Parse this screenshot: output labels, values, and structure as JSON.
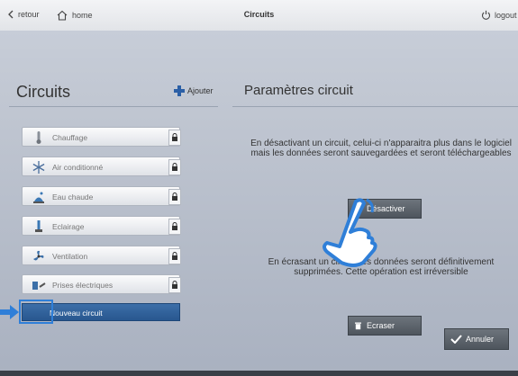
{
  "topbar": {
    "back_label": "retour",
    "home_label": "home",
    "title": "Circuits",
    "logout_label": "logout"
  },
  "left": {
    "heading": "Circuits",
    "add_label": "Ajouter",
    "items": [
      {
        "label": "Chauffage",
        "icon": "thermometer-icon"
      },
      {
        "label": "Air conditionné",
        "icon": "snowflake-icon"
      },
      {
        "label": "Eau chaude",
        "icon": "water-tap-icon"
      },
      {
        "label": "Eclairage",
        "icon": "lamp-icon"
      },
      {
        "label": "Ventilation",
        "icon": "fan-icon"
      },
      {
        "label": "Prises électriques",
        "icon": "plug-icon"
      }
    ],
    "new_circuit_label": "Nouveau circuit"
  },
  "right": {
    "heading": "Paramètres circuit",
    "deactivate_text": "En désactivant un circuit, celui-ci n'apparaitra plus dans le logiciel mais les données seront sauvegardées et seront téléchargeables",
    "deactivate_button": "Désactiver",
    "overwrite_text": "En écrasant un circuit, les données seront définitivement supprimées. Cette opération est irréversible",
    "overwrite_button": "Ecraser",
    "cancel_button": "Annuler"
  },
  "colors": {
    "accent": "#2b5fa6",
    "selected_item": "#2f6299",
    "highlight": "#2f7fd8",
    "dark_button": "#5a6169"
  }
}
